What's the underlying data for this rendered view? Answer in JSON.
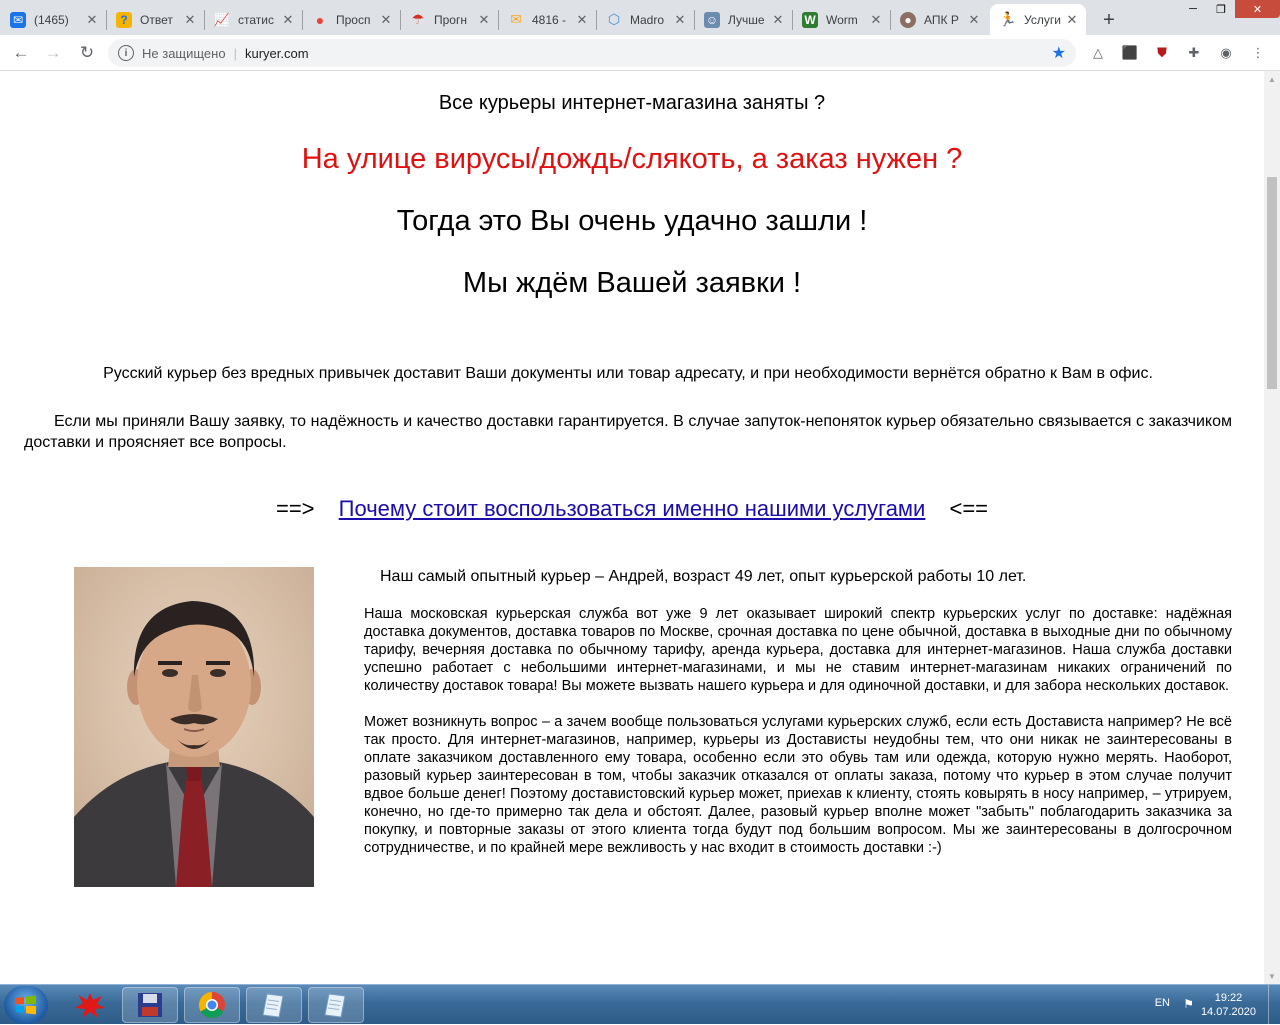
{
  "browser": {
    "tabs": [
      {
        "title": "(1465)",
        "icon": "mail-icon",
        "color": "#1a73e8"
      },
      {
        "title": "Ответ",
        "icon": "question-icon",
        "color": "#f4b400"
      },
      {
        "title": "статис",
        "icon": "chart-icon",
        "color": "#34a853"
      },
      {
        "title": "Просп",
        "icon": "map-pin-icon",
        "color": "#ea4335"
      },
      {
        "title": "Прогн",
        "icon": "umbrella-icon",
        "color": "#d93025"
      },
      {
        "title": "4816 -",
        "icon": "envelope-icon",
        "color": "#f9a825"
      },
      {
        "title": "Madro",
        "icon": "cube-icon",
        "color": "#4a90d9"
      },
      {
        "title": "Лучше",
        "icon": "site-icon",
        "color": "#6b8cae"
      },
      {
        "title": "Worm",
        "icon": "worm-icon",
        "color": "#2e7d32"
      },
      {
        "title": "АПК Р",
        "icon": "avatar-icon",
        "color": "#8d6e63"
      },
      {
        "title": "Услуги",
        "icon": "runner-icon",
        "color": "#d32f2f",
        "active": true
      }
    ],
    "security_label": "Не защищено",
    "url": "kuryer.com"
  },
  "page": {
    "headline1": "Все курьеры интернет-магазина заняты ?",
    "headline2": "На улице вирусы/дождь/слякоть, а заказ нужен ?",
    "headline3": "Тогда это Вы очень удачно зашли !",
    "headline4": "Мы ждём Вашей заявки !",
    "para1": "Русский курьер без вредных привычек доставит Ваши документы или товар адресату, и при необходимости вернётся обратно к Вам в офис.",
    "para2": "Если мы приняли Вашу заявку, то надёжность и качество доставки гарантируется. В случае запуток-непоняток курьер обязательно связывается с заказчиком доставки и проясняет все вопросы.",
    "link_prefix": "==>",
    "link_text": "Почему стоит воспользоваться именно нашими услугами",
    "link_suffix": "<==",
    "photo_caption": "Наш самый опытный курьер – Андрей, возраст 49 лет, опыт курьерской работы 10 лет.",
    "body1": "Наша московская курьерская служба вот уже 9 лет оказывает широкий спектр курьерских услуг по доставке:  надёжная доставка документов, доставка товаров по Москве, срочная доставка по цене обычной, доставка в выходные дни по обычному тарифу, вечерняя доставка по обычному тарифу, аренда курьера, доставка для интернет-магазинов.  Наша служба доставки успешно работает с небольшими интернет-магазинами, и мы не ставим интернет-магазинам никаких ограничений по количеству доставок товара!  Вы можете вызвать нашего курьера и для одиночной доставки, и для забора нескольких доставок.",
    "body2": "Может возникнуть вопрос – а зачем вообще пользоваться услугами курьерских служб, если есть Достависта например?  Не всё так просто. Для интернет-магазинов, например, курьеры из Достависты неудобны тем, что они никак не заинтересованы в оплате заказчиком доставленного ему товара, особенно если это обувь там или одежда, которую нужно мерять. Наоборот, разовый курьер заинтересован в том, чтобы заказчик отказался от оплаты заказа, потому что курьер в этом случае получит вдвое больше денег! Поэтому доставистовский курьер может, приехав к клиенту, стоять ковырять в носу например, – утрируем, конечно, но где-то примерно так дела и обстоят. Далее, разовый курьер вполне может \"забыть\" поблагодарить заказчика за покупку, и повторные заказы от этого клиента тогда будут под большим вопросом.  Мы же заинтересованы в долгосрочном сотрудничестве, и по крайней мере вежливость у нас входит в стоимость доставки :-)"
  },
  "colors": {
    "headline_red": "#e01010",
    "link": "#1a0dab"
  },
  "taskbar": {
    "lang": "EN",
    "time": "19:22",
    "date": "14.07.2020"
  }
}
